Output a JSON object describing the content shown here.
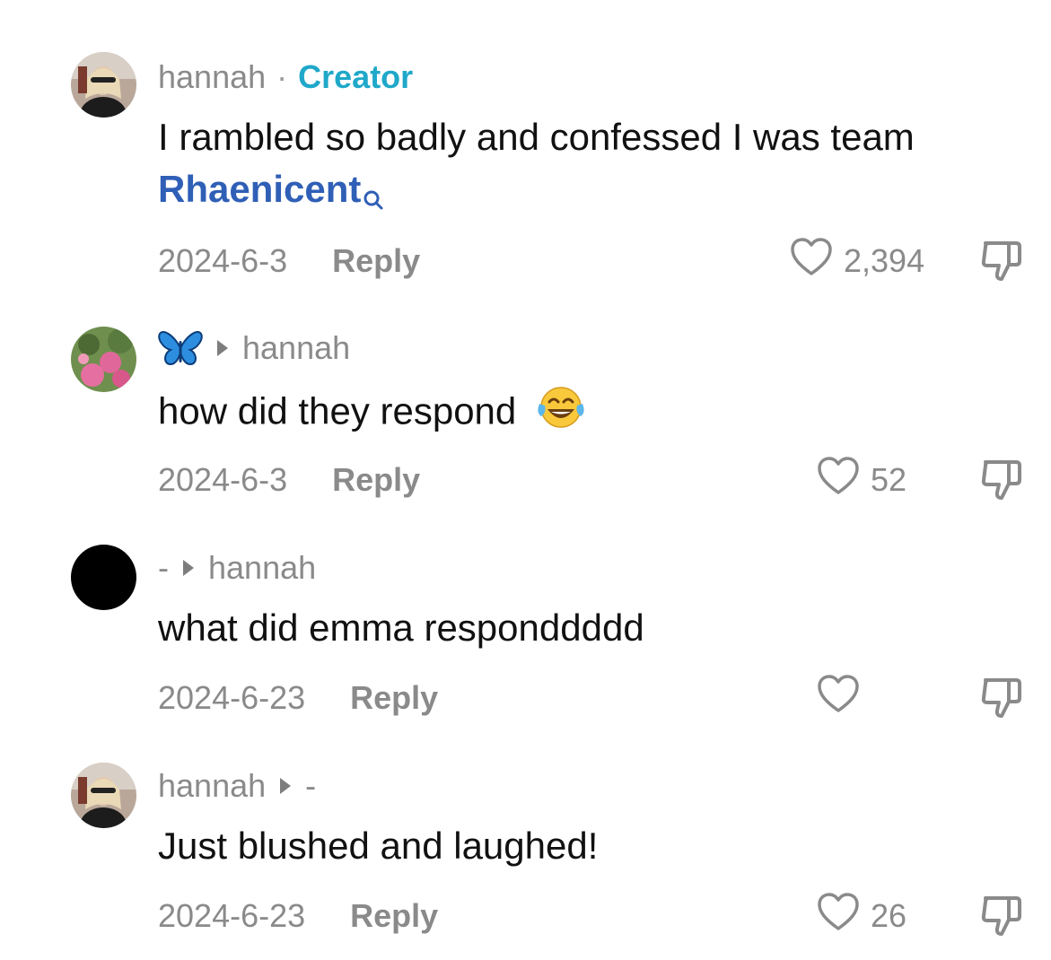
{
  "comments": [
    {
      "author": "hannah",
      "separator": "·",
      "badge": "Creator",
      "text": "I rambled so badly and confessed I was team",
      "tag": "Rhaenicent",
      "date": "2024-6-3",
      "reply_label": "Reply",
      "likes": "2,394"
    },
    {
      "author_emoji": "butterfly-emoji",
      "reply_to": "hannah",
      "text": "how did they respond",
      "text_emoji": "tears-of-joy-emoji",
      "date": "2024-6-3",
      "reply_label": "Reply",
      "likes": "52"
    },
    {
      "author": "-",
      "reply_to": "hannah",
      "text": "what did emma responddddd",
      "date": "2024-6-23",
      "reply_label": "Reply",
      "likes": ""
    },
    {
      "author": "hannah",
      "reply_to": "-",
      "text": "Just blushed and laughed!",
      "date": "2024-6-23",
      "reply_label": "Reply",
      "likes": "26"
    }
  ],
  "colors": {
    "creator_badge": "#1fa8c9",
    "tag_link": "#2f5fb6",
    "meta_gray": "#8a8a8a",
    "body_text": "#111111"
  },
  "icons": [
    "heart-outline-icon",
    "dislike-icon",
    "search-icon",
    "reply-caret-icon"
  ]
}
